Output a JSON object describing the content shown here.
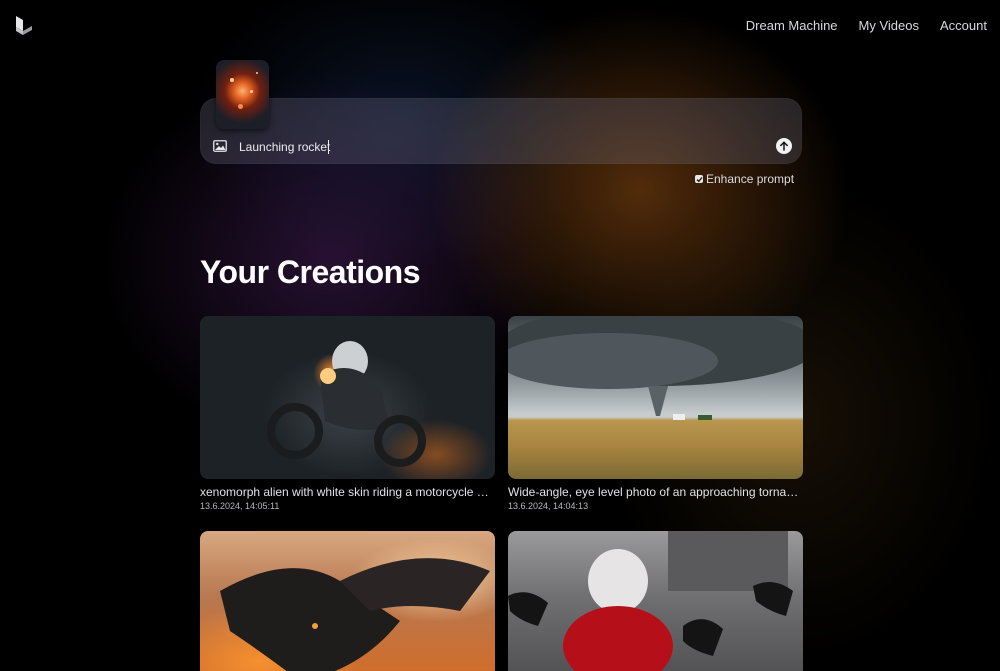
{
  "nav": {
    "links": [
      "Dream Machine",
      "My Videos",
      "Account"
    ]
  },
  "prompt": {
    "value": "Launching rocket",
    "enhance_label": "Enhance prompt",
    "enhance_checked": true
  },
  "section": {
    "title": "Your Creations"
  },
  "creations": [
    {
      "title": "xenomorph alien with white skin riding a motorcycle wi...",
      "date": "13.6.2024, 14:05:11"
    },
    {
      "title": "Wide-angle, eye level photo of an approaching tornado ...",
      "date": "13.6.2024, 14:04:13"
    },
    {
      "title": "",
      "date": ""
    },
    {
      "title": "",
      "date": ""
    }
  ],
  "icons": {
    "logo": "logo-icon",
    "image": "image-icon",
    "send": "arrow-up-icon",
    "check": "check-icon"
  }
}
